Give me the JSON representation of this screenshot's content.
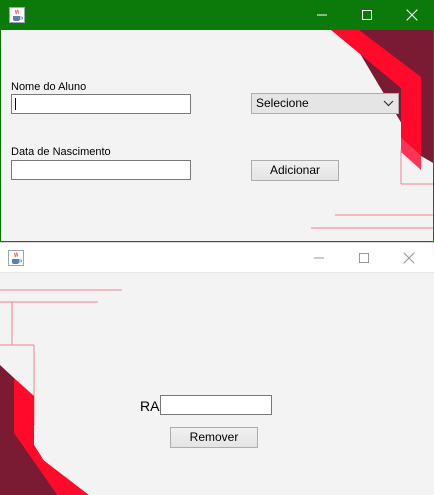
{
  "colors": {
    "titlebar_active": "#0b7a0b",
    "accent_red": "#ff0a2b",
    "accent_dark": "#7a1a33",
    "line_pink": "#f08090"
  },
  "icons": {
    "app": "java-cup-icon",
    "minimize": "minimize-icon",
    "maximize": "maximize-icon",
    "close": "close-icon",
    "dropdown": "chevron-down-icon"
  },
  "window_add": {
    "title": "",
    "name_label": "Nome do Aluno",
    "name_value": "",
    "birth_label": "Data de Nascimento",
    "birth_value": "",
    "combo_selected": "Selecione",
    "add_button": "Adicionar"
  },
  "window_remove": {
    "title": "",
    "ra_label": "RA",
    "ra_value": "",
    "remove_button": "Remover"
  }
}
